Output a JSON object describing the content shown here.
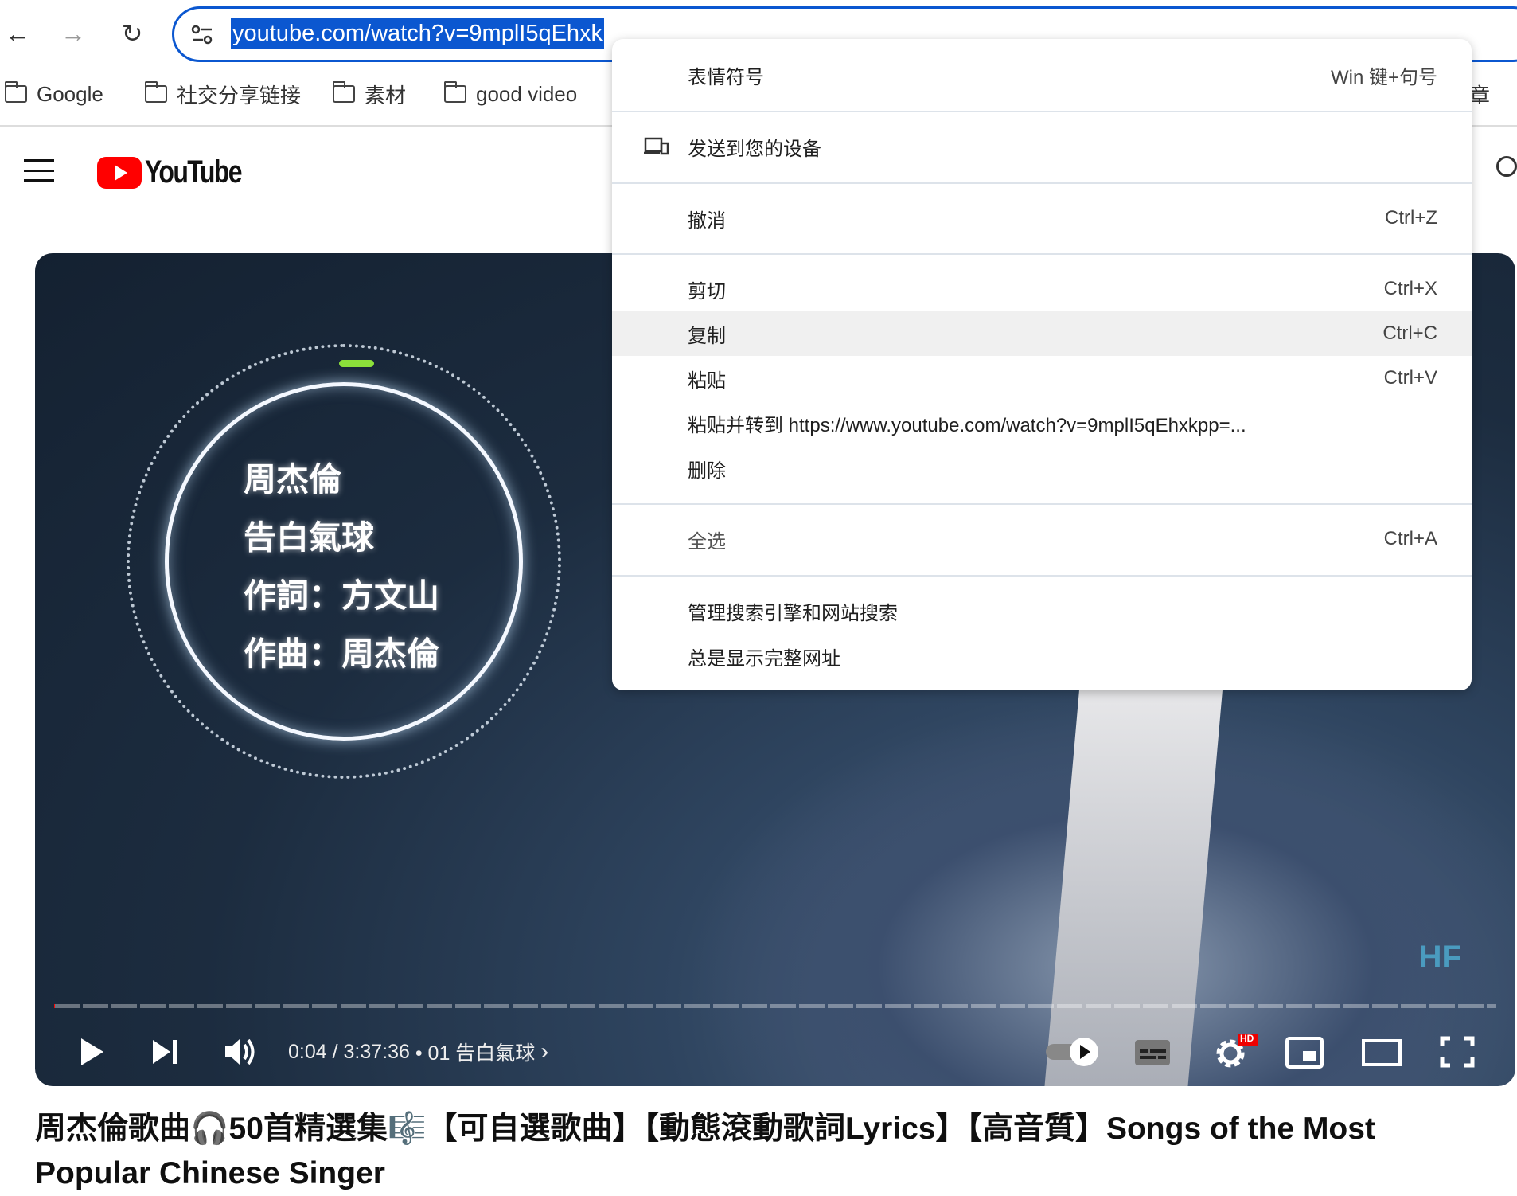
{
  "browser": {
    "back_icon": "arrow-left",
    "forward_icon": "arrow-right",
    "reload_icon": "reload",
    "url": "youtube.com/watch?v=9mplI5qEhxk",
    "bookmarks": [
      {
        "label": "Google"
      },
      {
        "label": "社交分享链接"
      },
      {
        "label": "素材"
      },
      {
        "label": "good video"
      }
    ],
    "bookmark_overflow": "章"
  },
  "youtube": {
    "logo_text": "YouTube"
  },
  "video": {
    "lyrics": [
      "周杰倫",
      "告白氣球",
      "作詞：方文山",
      "作曲：周杰倫"
    ],
    "watermark": "HF",
    "time": "0:04 / 3:37:36",
    "chapter": "• 01 告白氣球",
    "progress_percent": 0.03,
    "hd_badge": "HD",
    "accent": "#ff0000"
  },
  "title": "周杰倫歌曲🎧50首精選集🎼【可自選歌曲】【動態滾動歌詞Lyrics】【高音質】Songs of the Most Popular Chinese Singer",
  "context_menu": {
    "items": [
      {
        "label": "表情符号",
        "shortcut": "Win 键+句号"
      },
      {
        "label": "发送到您的设备",
        "icon": "devices"
      },
      {
        "label": "撤消",
        "shortcut": "Ctrl+Z"
      },
      {
        "label": "剪切",
        "shortcut": "Ctrl+X"
      },
      {
        "label": "复制",
        "shortcut": "Ctrl+C",
        "highlighted": true
      },
      {
        "label": "粘贴",
        "shortcut": "Ctrl+V"
      },
      {
        "label": "粘贴并转到 https://www.youtube.com/watch?v=9mplI5qEhxkpp=..."
      },
      {
        "label": "删除"
      },
      {
        "label": "全选",
        "shortcut": "Ctrl+A"
      },
      {
        "label": "管理搜索引擎和网站搜索"
      },
      {
        "label": "总是显示完整网址"
      }
    ]
  }
}
